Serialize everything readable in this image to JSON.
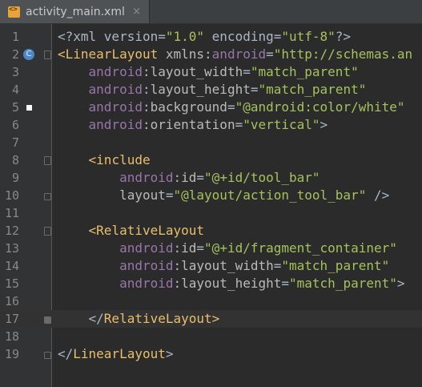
{
  "tab": {
    "filename": "activity_main.xml",
    "close": "×"
  },
  "lines": [
    {
      "n": "1",
      "seg": [
        [
          "t-plain",
          "<?xml version="
        ],
        [
          "t-val",
          "\"1.0\""
        ],
        [
          "t-plain",
          " encoding="
        ],
        [
          "t-val",
          "\"utf-8\""
        ],
        [
          "t-plain",
          "?>"
        ]
      ]
    },
    {
      "n": "2",
      "seg": [
        [
          "t-brk",
          "<"
        ],
        [
          "t-tag",
          "LinearLayout"
        ],
        [
          "t-plain",
          " "
        ],
        [
          "t-attr",
          "xmlns:"
        ],
        [
          "t-ns",
          "android"
        ],
        [
          "t-plain",
          "="
        ],
        [
          "t-val",
          "\"http://schemas.an"
        ]
      ]
    },
    {
      "n": "3",
      "seg": [
        [
          "t-plain",
          "    "
        ],
        [
          "t-ns",
          "android"
        ],
        [
          "t-plain",
          ":"
        ],
        [
          "t-attr",
          "layout_width"
        ],
        [
          "t-plain",
          "="
        ],
        [
          "t-val",
          "\"match_parent\""
        ]
      ]
    },
    {
      "n": "4",
      "seg": [
        [
          "t-plain",
          "    "
        ],
        [
          "t-ns",
          "android"
        ],
        [
          "t-plain",
          ":"
        ],
        [
          "t-attr",
          "layout_height"
        ],
        [
          "t-plain",
          "="
        ],
        [
          "t-val",
          "\"match_parent\""
        ]
      ]
    },
    {
      "n": "5",
      "seg": [
        [
          "t-plain",
          "    "
        ],
        [
          "t-ns",
          "android"
        ],
        [
          "t-plain",
          ":"
        ],
        [
          "t-attr",
          "background"
        ],
        [
          "t-plain",
          "="
        ],
        [
          "t-val",
          "\"@android:color/white\""
        ]
      ]
    },
    {
      "n": "6",
      "seg": [
        [
          "t-plain",
          "    "
        ],
        [
          "t-ns",
          "android"
        ],
        [
          "t-plain",
          ":"
        ],
        [
          "t-attr",
          "orientation"
        ],
        [
          "t-plain",
          "="
        ],
        [
          "t-val",
          "\"vertical\""
        ],
        [
          "t-plain",
          ">"
        ]
      ]
    },
    {
      "n": "7",
      "seg": []
    },
    {
      "n": "8",
      "seg": [
        [
          "t-plain",
          "    "
        ],
        [
          "t-brk",
          "<"
        ],
        [
          "t-tag",
          "include"
        ]
      ]
    },
    {
      "n": "9",
      "seg": [
        [
          "t-plain",
          "        "
        ],
        [
          "t-ns",
          "android"
        ],
        [
          "t-plain",
          ":"
        ],
        [
          "t-attr",
          "id"
        ],
        [
          "t-plain",
          "="
        ],
        [
          "t-val",
          "\"@+id/tool_bar\""
        ]
      ]
    },
    {
      "n": "10",
      "seg": [
        [
          "t-plain",
          "        "
        ],
        [
          "t-attr",
          "layout"
        ],
        [
          "t-plain",
          "="
        ],
        [
          "t-val",
          "\"@layout/action_tool_bar\""
        ],
        [
          "t-plain",
          " />"
        ]
      ]
    },
    {
      "n": "11",
      "seg": []
    },
    {
      "n": "12",
      "seg": [
        [
          "t-plain",
          "    "
        ],
        [
          "t-brk",
          "<"
        ],
        [
          "t-tag",
          "RelativeLayout"
        ]
      ]
    },
    {
      "n": "13",
      "seg": [
        [
          "t-plain",
          "        "
        ],
        [
          "t-ns",
          "android"
        ],
        [
          "t-plain",
          ":"
        ],
        [
          "t-attr",
          "id"
        ],
        [
          "t-plain",
          "="
        ],
        [
          "t-val",
          "\"@+id/fragment_container\""
        ]
      ]
    },
    {
      "n": "14",
      "seg": [
        [
          "t-plain",
          "        "
        ],
        [
          "t-ns",
          "android"
        ],
        [
          "t-plain",
          ":"
        ],
        [
          "t-attr",
          "layout_width"
        ],
        [
          "t-plain",
          "="
        ],
        [
          "t-val",
          "\"match_parent\""
        ]
      ]
    },
    {
      "n": "15",
      "seg": [
        [
          "t-plain",
          "        "
        ],
        [
          "t-ns",
          "android"
        ],
        [
          "t-plain",
          ":"
        ],
        [
          "t-attr",
          "layout_height"
        ],
        [
          "t-plain",
          "="
        ],
        [
          "t-val",
          "\"match_parent\""
        ],
        [
          "t-plain",
          ">"
        ]
      ]
    },
    {
      "n": "16",
      "seg": []
    },
    {
      "n": "17",
      "seg": [
        [
          "t-plain",
          "    </"
        ],
        [
          "t-tag",
          "RelativeLayout"
        ],
        [
          "t-brk",
          ">"
        ]
      ]
    },
    {
      "n": "18",
      "seg": []
    },
    {
      "n": "19",
      "seg": [
        [
          "t-plain",
          "</"
        ],
        [
          "t-tag",
          "LinearLayout"
        ],
        [
          "t-plain",
          ">"
        ]
      ]
    }
  ],
  "gutter_markers": {
    "line2": "C"
  },
  "colors": {
    "background": "#2b2b2b",
    "gutter": "#313335",
    "tag": "#e8bf6a",
    "namespace": "#9876aa",
    "attribute": "#bababa",
    "value": "#a5c25c",
    "text": "#a9b7c6"
  }
}
